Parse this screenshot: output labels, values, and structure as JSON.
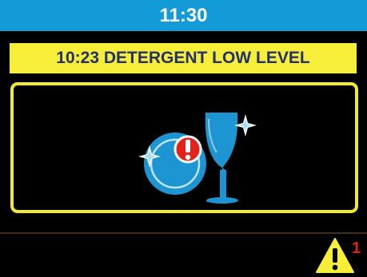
{
  "header": {
    "time": "11:30"
  },
  "alarm": {
    "message": "10:23 DETERGENT LOW LEVEL",
    "icon": "dishes-alert-icon"
  },
  "status_bar": {
    "warning_icon": "warning-triangle-icon",
    "warning_count": "1"
  },
  "colors": {
    "header_blue": "#139bd8",
    "alarm_yellow": "#f6ee39",
    "alarm_text": "#24306c",
    "icon_blue": "#1d95d3",
    "alert_red": "#e3221b"
  }
}
